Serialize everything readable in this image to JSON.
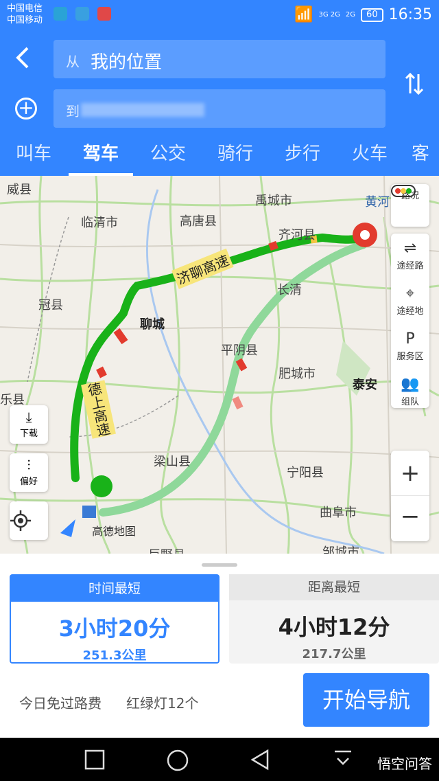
{
  "status_bar": {
    "carrier1": "中国电信",
    "carrier2": "中国移动",
    "network": "3G 2G",
    "network2": "2G",
    "battery": "60",
    "time": "16:35"
  },
  "header": {
    "from_prefix": "从",
    "from_value": "我的位置",
    "to_prefix": "到",
    "tabs": [
      "叫车",
      "驾车",
      "公交",
      "骑行",
      "步行",
      "火车",
      "客"
    ]
  },
  "map": {
    "labels": {
      "weixian": "威县",
      "yucheng": "禹城市",
      "huanghe": "黄河",
      "linqing": "临清市",
      "gaotang": "高唐县",
      "qihe": "齐河县",
      "guanxian": "冠县",
      "liaocheng": "聊城",
      "changqing": "长清",
      "pingyin": "平阴县",
      "feicheng": "肥城市",
      "taian": "泰安",
      "leling": "乐县",
      "liangshan": "梁山县",
      "ningyang": "宁阳县",
      "qufu": "曲阜市",
      "zoucheng": "邹城市",
      "juye": "巨野县",
      "gaode": "高德地图",
      "highway1": "济聊高速",
      "highway2": "德上高速"
    },
    "right_controls": [
      "路况",
      "途经路",
      "途经地",
      "服务区",
      "组队"
    ],
    "download": "下载",
    "preference": "偏好",
    "zoom_in": "+",
    "zoom_out": "−"
  },
  "routes": [
    {
      "title": "时间最短",
      "time": "3小时20分",
      "distance": "251.3公里"
    },
    {
      "title": "距离最短",
      "time": "4小时12分",
      "distance": "217.7公里"
    }
  ],
  "bottom": {
    "toll": "今日免过路费",
    "lights": "红绿灯12个",
    "start": "开始导航"
  },
  "watermark": "悟空问答",
  "colors": {
    "primary": "#3385ff",
    "route_main": "#19b219",
    "route_alt": "#8fd89a",
    "congestion": "#e23b2e"
  }
}
